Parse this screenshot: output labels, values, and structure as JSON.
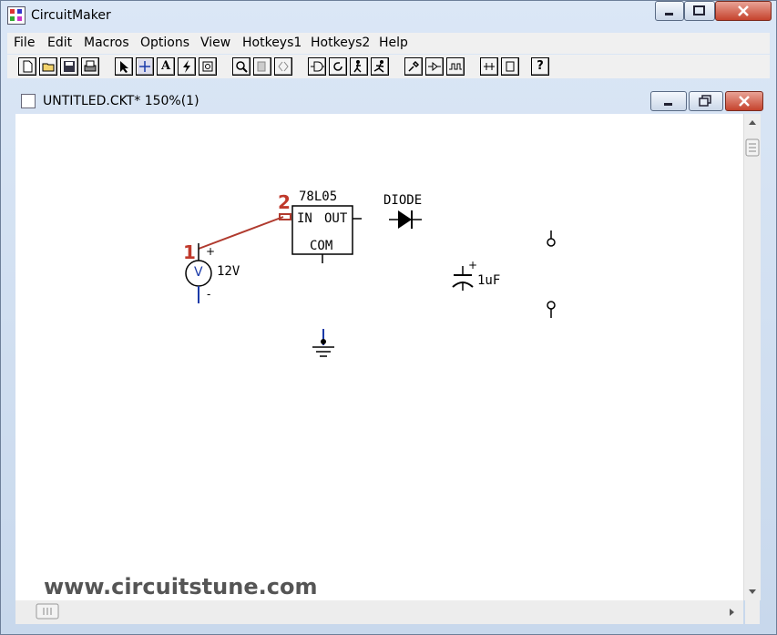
{
  "app": {
    "title": "CircuitMaker"
  },
  "menu": [
    "File",
    "Edit",
    "Macros",
    "Options",
    "View",
    "Hotkeys1",
    "Hotkeys2",
    "Help"
  ],
  "toolbar": {
    "icons": [
      "new-file",
      "open-folder",
      "save",
      "print",
      "arrow-select",
      "crosshair-wire",
      "text-tool",
      "probe-lightning",
      "zoom-window",
      "magnifier",
      "copy-page",
      "split-view",
      "logic-gate",
      "rotate",
      "step",
      "run",
      "probe",
      "signal",
      "waveform",
      "bus",
      "component",
      "help"
    ],
    "text_label": "A",
    "help_label": "?"
  },
  "document": {
    "title": "UNTITLED.CKT* 150%(1)"
  },
  "schematic": {
    "regulator": {
      "name": "78L05",
      "pin_in": "IN",
      "pin_out": "OUT",
      "pin_com": "COM"
    },
    "diode_label": "DIODE",
    "source": {
      "symbol": "V",
      "value": "12V",
      "plus": "+",
      "minus": "-"
    },
    "capacitor": {
      "value": "1uF",
      "plus": "+"
    },
    "step_markers": [
      "1",
      "2"
    ]
  },
  "watermark": "www.circuitstune.com",
  "colors": {
    "wire": "#b03a2e",
    "marker": "#c0392b",
    "pin_blue": "#1a3aa8",
    "frame": "#c9d9ee"
  }
}
